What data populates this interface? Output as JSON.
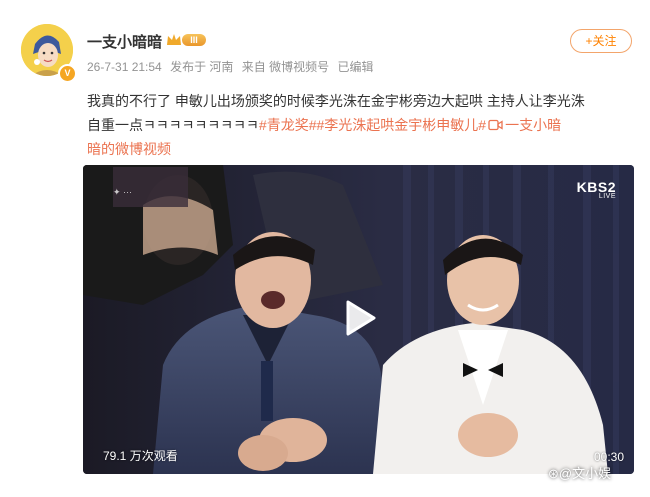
{
  "post": {
    "username": "一支小暗暗",
    "level_badge": "III",
    "verify_badge": "V",
    "follow_label": "+关注",
    "meta": {
      "time": "26-7-31 21:54",
      "location": "发布于 河南",
      "source": "来自 微博视频号",
      "edited": "已编辑"
    },
    "text": {
      "line1": "我真的不行了 申敏儿出场颁奖的时候李光洙在金宇彬旁边大起哄 主持人让李光洙",
      "line2_plain": "自重一点ㅋㅋㅋㅋㅋㅋㅋㅋㅋ",
      "topic1": "#青龙奖#",
      "topic2": "#李光洙起哄金宇彬申敏儿#",
      "video_link_icon": "video-link-icon",
      "video_link": "一支小暗",
      "line3": "暗的微博视频"
    },
    "video": {
      "channel_logo": "KBS2",
      "channel_sub": "LIVE",
      "views": "79.1 万次观看",
      "duration": "00:30"
    },
    "watermark": "⊛@文小娱"
  },
  "colors": {
    "accent": "#ff8200",
    "topic": "#eb7350",
    "meta": "#939393"
  }
}
